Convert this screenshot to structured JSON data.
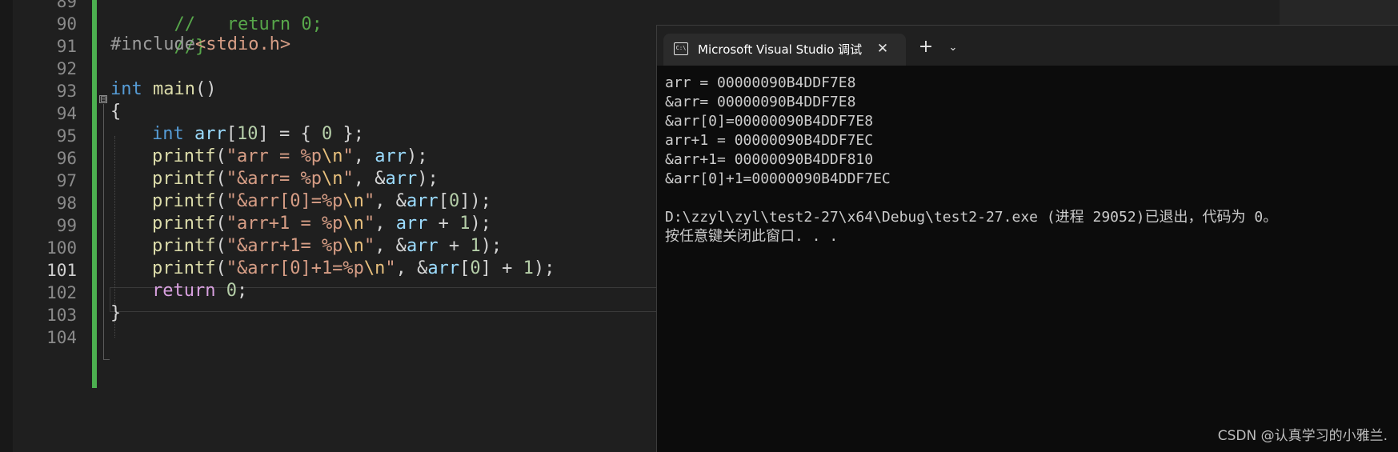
{
  "editor": {
    "line_numbers": [
      "89",
      "90",
      "91",
      "92",
      "93",
      "94",
      "95",
      "96",
      "97",
      "98",
      "99",
      "100",
      "101",
      "102",
      "103",
      "104"
    ],
    "active_line": "101",
    "fold_toggle_symbol": "⊟",
    "lines": {
      "l89": {
        "comment": "//   return 0;"
      },
      "l90": {
        "comment": "//}"
      },
      "l91": {
        "directive": "#include",
        "header": "<stdio.h>"
      },
      "l93": {
        "kw": "int",
        "fn": "main",
        "punct": "()"
      },
      "l94": {
        "punct": "{"
      },
      "l95": {
        "kw": "int",
        "var": "arr",
        "open": "[",
        "size": "10",
        "close": "] = { ",
        "zero": "0",
        "end": " };"
      },
      "l96": {
        "fn": "printf",
        "open": "(",
        "str": "\"arr = %p",
        "esc": "\\n",
        "strend": "\"",
        "sep": ", ",
        "var": "arr",
        "end": ");"
      },
      "l97": {
        "fn": "printf",
        "open": "(",
        "str": "\"&arr= %p",
        "esc": "\\n",
        "strend": "\"",
        "sep": ", &",
        "var": "arr",
        "end": ");"
      },
      "l98": {
        "fn": "printf",
        "open": "(",
        "str": "\"&arr[0]=%p",
        "esc": "\\n",
        "strend": "\"",
        "sep": ", &",
        "var": "arr",
        "idx_open": "[",
        "idx": "0",
        "end": "]);"
      },
      "l99": {
        "fn": "printf",
        "open": "(",
        "str": "\"arr+1 = %p",
        "esc": "\\n",
        "strend": "\"",
        "sep": ", ",
        "var": "arr",
        "plus": " + ",
        "one": "1",
        "end": ");"
      },
      "l100": {
        "fn": "printf",
        "open": "(",
        "str": "\"&arr+1= %p",
        "esc": "\\n",
        "strend": "\"",
        "sep": ", &",
        "var": "arr",
        "plus": " + ",
        "one": "1",
        "end": ");"
      },
      "l101": {
        "fn": "printf",
        "open": "(",
        "str": "\"&arr[0]+1=%p",
        "esc": "\\n",
        "strend": "\"",
        "sep": ", &",
        "var": "arr",
        "idx_open": "[",
        "idx": "0",
        "idx_close": "]",
        "plus": " + ",
        "one": "1",
        "end": ");"
      },
      "l102": {
        "kw": "return",
        "zero": "0",
        "end": ";"
      },
      "l103": {
        "punct": "}"
      }
    }
  },
  "terminal": {
    "tab_title": "Microsoft Visual Studio 调试控制台",
    "tab_icon_text": "C:\\",
    "close_symbol": "✕",
    "new_tab_symbol": "+",
    "dropdown_symbol": "⌄",
    "output_lines": [
      "arr = 00000090B4DDF7E8",
      "&arr= 00000090B4DDF7E8",
      "&arr[0]=00000090B4DDF7E8",
      "arr+1 = 00000090B4DDF7EC",
      "&arr+1= 00000090B4DDF810",
      "&arr[0]+1=00000090B4DDF7EC",
      "",
      "D:\\zzyl\\zyl\\test2-27\\x64\\Debug\\test2-27.exe (进程 29052)已退出，代码为 0。",
      "按任意键关闭此窗口. . ."
    ]
  },
  "watermark": "CSDN @认真学习的小雅兰.",
  "colors": {
    "editor_bg": "#1f1f1f",
    "change_bar": "#4caf50",
    "keyword": "#569cd6",
    "function": "#dcdcaa",
    "variable": "#9cdcfe",
    "string": "#d69d85",
    "escape": "#e8c07d",
    "number": "#b5cea8",
    "control": "#d8a0df",
    "comment": "#57a64a",
    "terminal_bg": "#0c0c0c"
  }
}
